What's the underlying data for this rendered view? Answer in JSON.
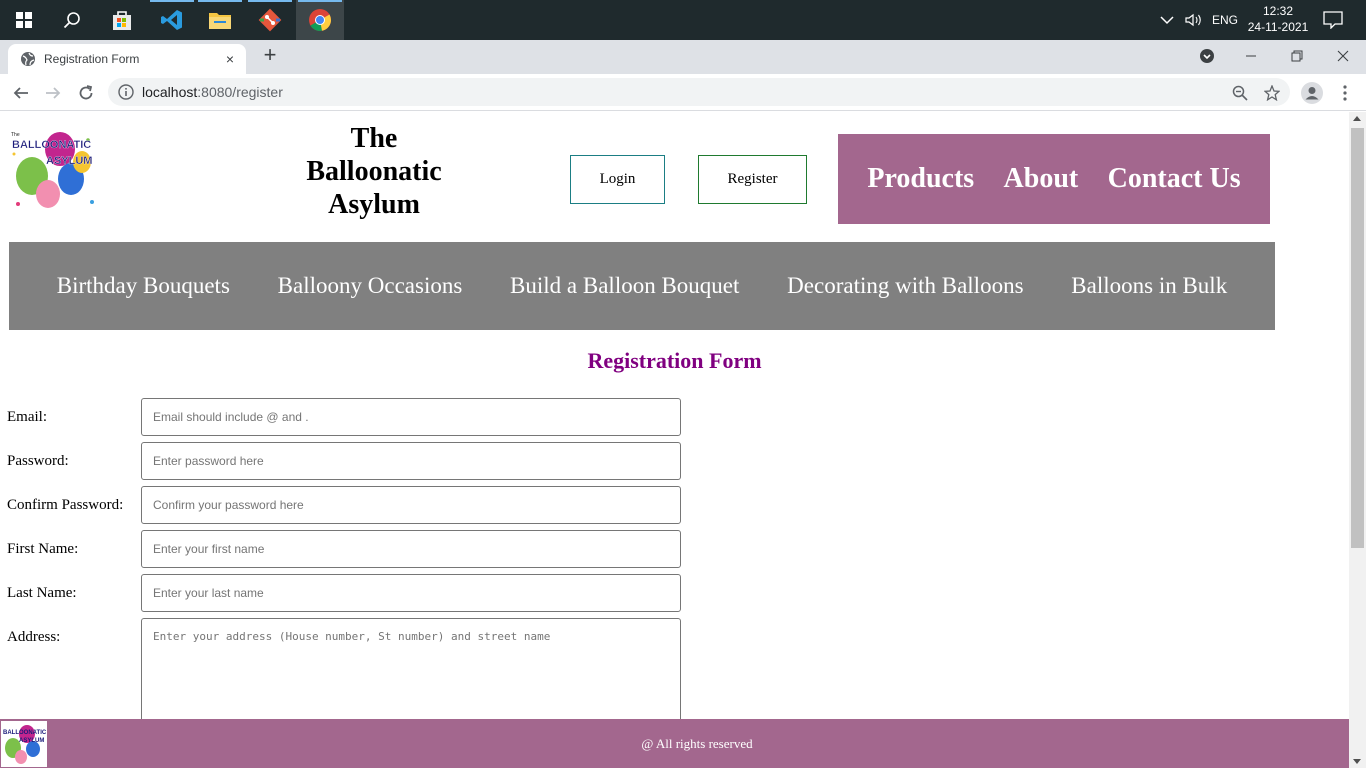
{
  "taskbar": {
    "apps": [
      "start-icon",
      "search-icon",
      "store-icon",
      "vscode-icon",
      "file-explorer-icon",
      "git-icon",
      "chrome-icon"
    ],
    "language": "ENG",
    "time": "12:32",
    "date": "24-11-2021"
  },
  "browser": {
    "tab_title": "Registration Form",
    "url_host": "localhost",
    "url_path": ":8080/register",
    "new_tab_label": "+",
    "tab_close_label": "×"
  },
  "header": {
    "title_line1": "The",
    "title_line2": "Balloonatic",
    "title_line3": "Asylum",
    "login_label": "Login",
    "register_label": "Register",
    "nav": {
      "products": "Products",
      "about": "About",
      "contact": "Contact Us"
    },
    "nav_color": "#a3678e"
  },
  "categories": {
    "birthday": "Birthday Bouquets",
    "occasions": "Balloony Occasions",
    "build": "Build a Balloon Bouquet",
    "decorating": "Decorating with Balloons",
    "bulk": "Balloons in Bulk",
    "bar_color": "#808080"
  },
  "form": {
    "heading": "Registration Form",
    "heading_color": "#800080",
    "email": {
      "label": "Email:",
      "value": "",
      "placeholder": "Email should include @ and ."
    },
    "password": {
      "label": "Password:",
      "value": "",
      "placeholder": "Enter password here"
    },
    "confirm_password": {
      "label": "Confirm Password:",
      "value": "",
      "placeholder": "Confirm your password here"
    },
    "first_name": {
      "label": "First Name:",
      "value": "",
      "placeholder": "Enter your first name"
    },
    "last_name": {
      "label": "Last Name:",
      "value": "",
      "placeholder": "Enter your last name"
    },
    "address": {
      "label": "Address:",
      "value": "",
      "placeholder": "Enter your address (House number, St number) and street name"
    }
  },
  "footer": {
    "text": "@ All rights reserved"
  }
}
